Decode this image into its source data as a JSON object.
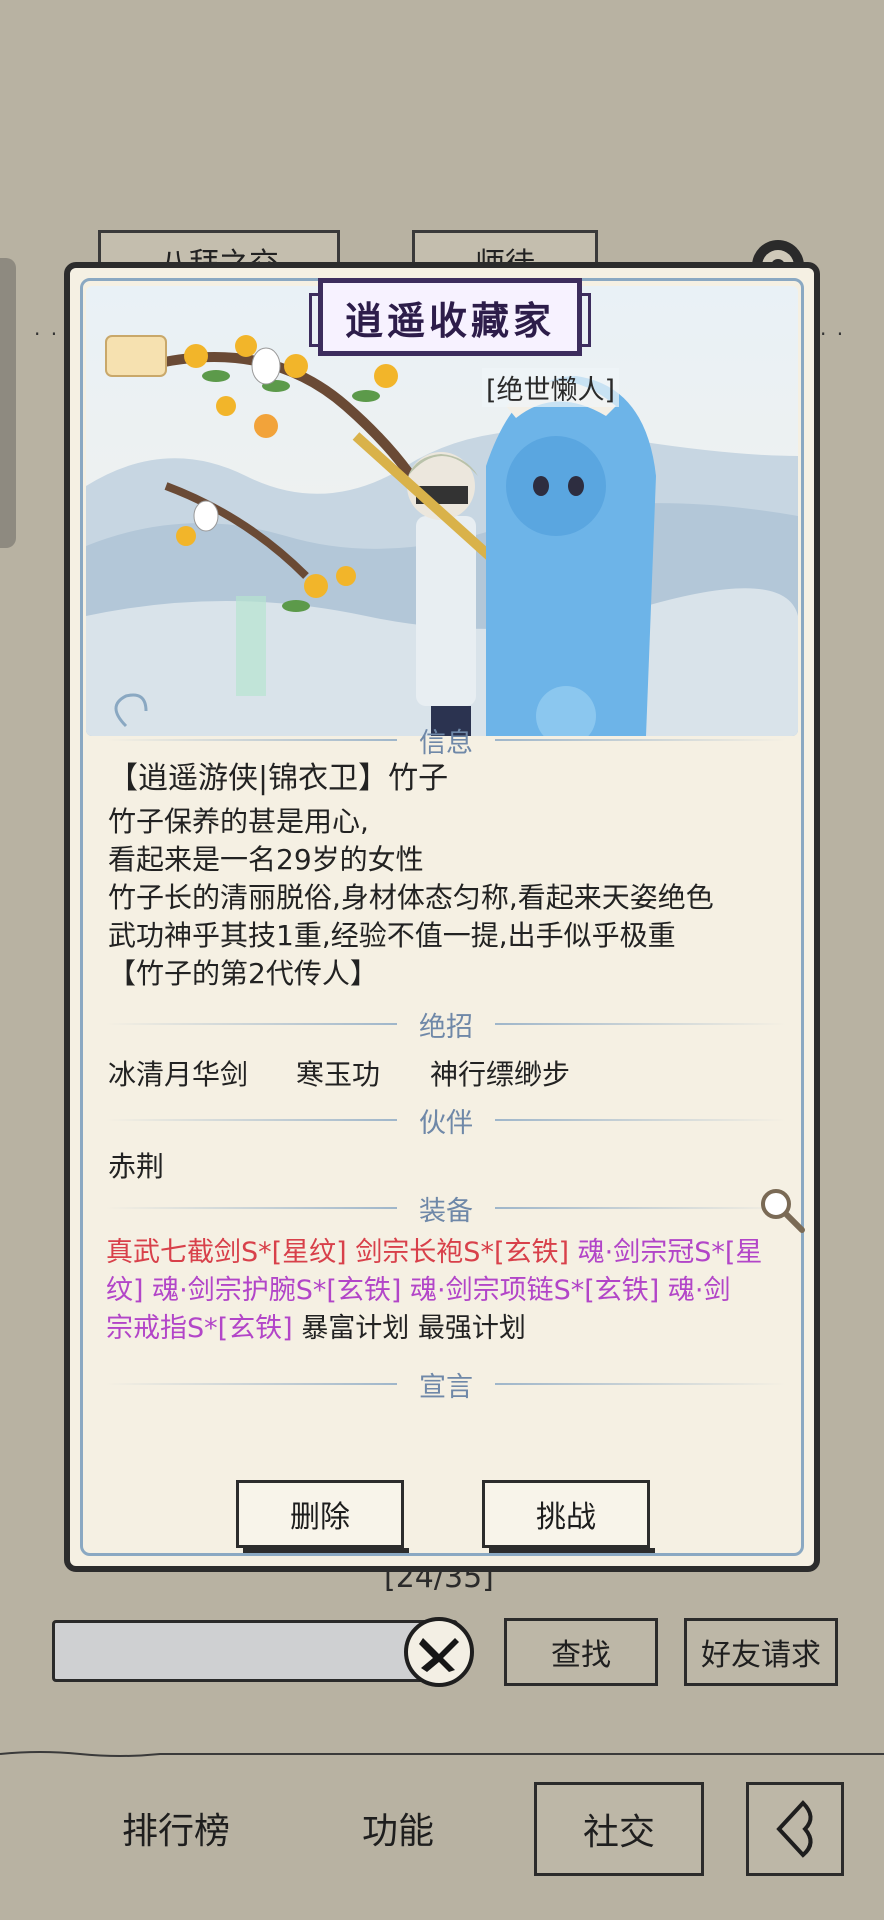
{
  "background": {
    "tabs": [
      "八拜之交",
      "师徒"
    ],
    "page_counter": "[24/35]",
    "search_placeholder": "",
    "find_button": "查找",
    "friend_request_button": "好友请求"
  },
  "bottom_nav": {
    "items": [
      "排行榜",
      "功能",
      "社交"
    ],
    "back_icon": "back-arrow-icon"
  },
  "modal": {
    "title": "逍遥收藏家",
    "tagline": "[绝世懒人]",
    "sections": {
      "info": "信息",
      "skills": "绝招",
      "partner": "伙伴",
      "equipment": "装备",
      "declaration": "宣言"
    },
    "info_lines": [
      "【逍遥游侠|锦衣卫】竹子",
      "竹子保养的甚是用心,",
      "看起来是一名29岁的女性",
      "竹子长的清丽脱俗,身材体态匀称,看起来天姿绝色",
      "武功神乎其技1重,经验不值一提,出手似乎极重",
      "【竹子的第2代传人】"
    ],
    "skills": [
      "冰清月华剑",
      "寒玉功",
      "神行缥缈步"
    ],
    "partner": "赤荆",
    "equipment_lines": [
      [
        {
          "text": "真武七截剑S*[星纹]",
          "color": "#d8404a"
        },
        {
          "text": "剑宗长袍S*[玄铁]",
          "color": "#d8404a"
        },
        {
          "text": "魂·剑宗冠S*[星",
          "color": "#b245c8"
        }
      ],
      [
        {
          "text": "纹]",
          "color": "#b245c8"
        },
        {
          "text": "魂·剑宗护腕S*[玄铁]",
          "color": "#b245c8"
        },
        {
          "text": "魂·剑宗项链S*[玄铁]",
          "color": "#b245c8"
        },
        {
          "text": "魂·剑",
          "color": "#b245c8"
        }
      ],
      [
        {
          "text": "宗戒指S*[玄铁]",
          "color": "#b245c8"
        },
        {
          "text": "暴富计划",
          "color": "#222222"
        },
        {
          "text": "最强计划",
          "color": "#222222"
        }
      ]
    ],
    "delete_button": "删除",
    "challenge_button": "挑战"
  },
  "colors": {
    "page_bg": "#b8b2a2",
    "modal_bg": "#f5f0e3",
    "section_blue": "#6f88a8",
    "equip_red": "#d8404a",
    "equip_purple": "#b245c8"
  }
}
